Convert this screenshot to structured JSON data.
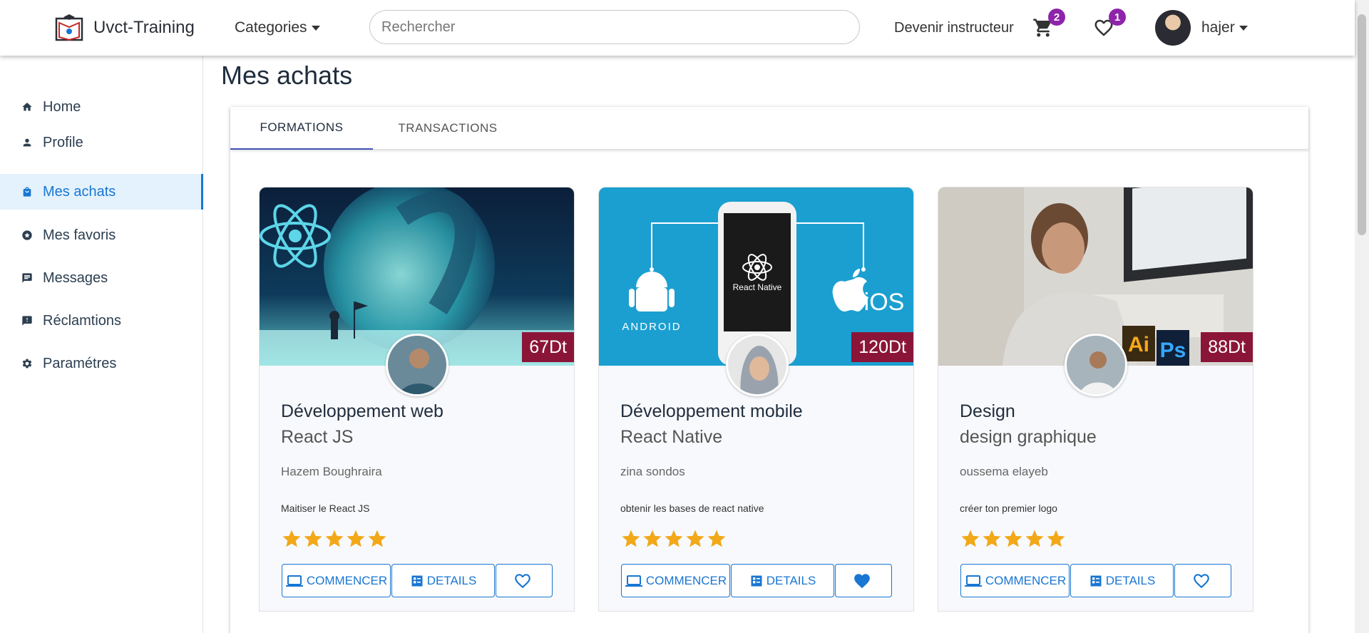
{
  "navbar": {
    "brand": "Uvct-Training",
    "categories_label": "Categories",
    "search_placeholder": "Rechercher",
    "become_instructor": "Devenir instructeur",
    "cart_count": "2",
    "favorites_count": "1",
    "user_name": "hajer"
  },
  "sidebar": {
    "items": [
      {
        "label": "Home",
        "icon": "home-icon"
      },
      {
        "label": "Profile",
        "icon": "person-icon"
      },
      {
        "label": "Mes achats",
        "icon": "shopping-bag-icon"
      },
      {
        "label": "Mes favoris",
        "icon": "star-circle-icon"
      },
      {
        "label": "Messages",
        "icon": "message-icon"
      },
      {
        "label": "Réclamtions",
        "icon": "report-icon"
      },
      {
        "label": "Paramétres",
        "icon": "gear-icon"
      }
    ],
    "active_index": 2
  },
  "page": {
    "title": "Mes achats",
    "tabs": [
      "FORMATIONS",
      "TRANSACTIONS"
    ]
  },
  "cards": [
    {
      "price": "67Dt",
      "title": "Développement web",
      "subtitle": "React JS",
      "author": "Hazem Boughraira",
      "description": "Maitiser le React JS",
      "rating": 5,
      "favorited": false,
      "start_label": "COMMENCER",
      "details_label": "DETAILS"
    },
    {
      "price": "120Dt",
      "title": "Développement mobile",
      "subtitle": "React Native",
      "author": "zina sondos",
      "description": "obtenir les bases de react native",
      "rating": 5,
      "favorited": true,
      "start_label": "COMMENCER",
      "details_label": "DETAILS",
      "image_text": "React Native",
      "image_android": "ANDROID",
      "image_ios": "iOS"
    },
    {
      "price": "88Dt",
      "title": "Design",
      "subtitle": "design graphique",
      "author": "oussema elayeb",
      "description": "créer ton premier logo",
      "rating": 5,
      "favorited": false,
      "start_label": "COMMENCER",
      "details_label": "DETAILS",
      "image_ai": "Ai",
      "image_ps": "Ps"
    }
  ],
  "colors": {
    "accent": "#1976d2",
    "price_bg": "#8b1538",
    "badge": "#8e24aa",
    "star": "#f2a818",
    "active_bg": "#e3f2fd"
  }
}
